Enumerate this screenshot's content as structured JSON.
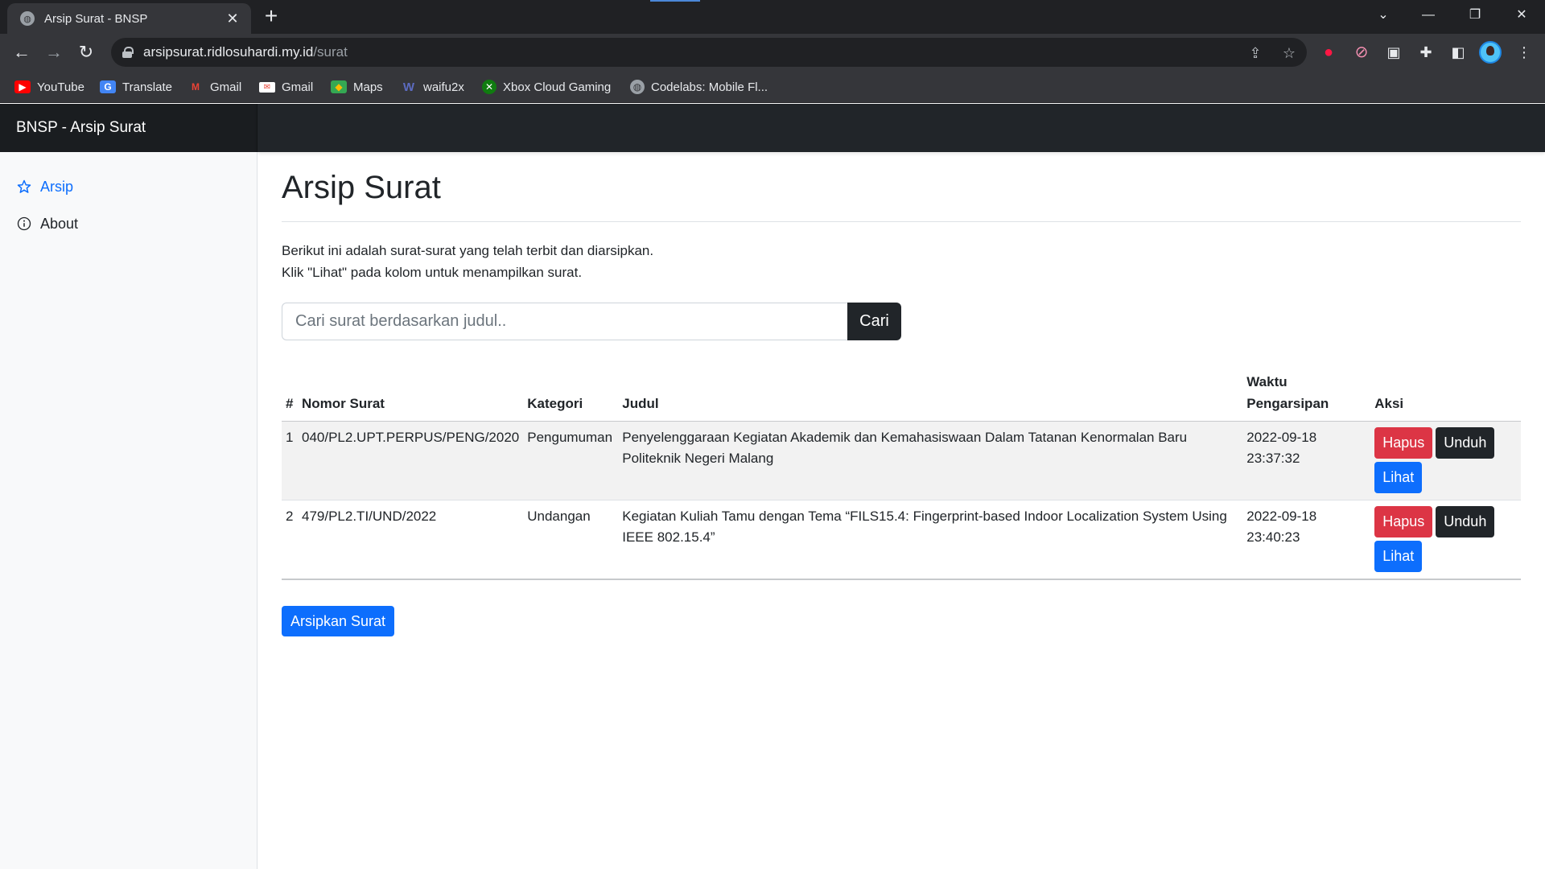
{
  "browser": {
    "tab_title": "Arsip Surat - BNSP",
    "url_host": "arsipsurat.ridlosuhardi.my.id",
    "url_path": "/surat",
    "bookmarks": [
      {
        "label": "YouTube",
        "icon": "youtube-icon",
        "color": "#ff0000"
      },
      {
        "label": "Translate",
        "icon": "translate-icon",
        "color": "#4285f4"
      },
      {
        "label": "Gmail",
        "icon": "gmail-icon",
        "color": "#ea4335"
      },
      {
        "label": "Gmail",
        "icon": "gmail-icon",
        "color": "#ea4335"
      },
      {
        "label": "Maps",
        "icon": "maps-icon",
        "color": "#34a853"
      },
      {
        "label": "waifu2x",
        "icon": "waifu2x-icon",
        "color": "#3f51b5"
      },
      {
        "label": "Xbox Cloud Gaming",
        "icon": "xbox-icon",
        "color": "#107c10"
      },
      {
        "label": "Codelabs: Mobile Fl...",
        "icon": "globe-icon",
        "color": "#9aa0a6"
      }
    ]
  },
  "app": {
    "brand": "BNSP - Arsip Surat"
  },
  "sidebar": {
    "items": [
      {
        "label": "Arsip",
        "icon": "star-icon",
        "active": true
      },
      {
        "label": "About",
        "icon": "info-icon",
        "active": false
      }
    ]
  },
  "main": {
    "title": "Arsip Surat",
    "intro_line1": "Berikut ini adalah surat-surat yang telah terbit dan diarsipkan.",
    "intro_line2": "Klik \"Lihat\" pada kolom untuk menampilkan surat.",
    "search": {
      "placeholder": "Cari surat berdasarkan judul..",
      "button": "Cari"
    },
    "table": {
      "headers": {
        "no": "#",
        "nomor": "Nomor Surat",
        "kategori": "Kategori",
        "judul": "Judul",
        "waktu_line1": "Waktu",
        "waktu_line2": "Pengarsipan",
        "aksi": "Aksi"
      },
      "actions": {
        "hapus": "Hapus",
        "unduh": "Unduh",
        "lihat": "Lihat"
      },
      "rows": [
        {
          "no": "1",
          "nomor": "040/PL2.UPT.PERPUS/PENG/2020",
          "kategori": "Pengumuman",
          "judul": "Penyelenggaraan Kegiatan Akademik dan Kemahasiswaan Dalam Tatanan Kenormalan Baru Politeknik Negeri Malang",
          "tanggal": "2022-09-18",
          "jam": "23:37:32"
        },
        {
          "no": "2",
          "nomor": "479/PL2.TI/UND/2022",
          "kategori": "Undangan",
          "judul": "Kegiatan Kuliah Tamu dengan Tema “FILS15.4: Fingerprint-based Indoor Localization System Using IEEE 802.15.4”",
          "tanggal": "2022-09-18",
          "jam": "23:40:23"
        }
      ]
    },
    "archive_button": "Arsipkan Surat"
  },
  "colors": {
    "primary": "#0d6efd",
    "danger": "#dc3545",
    "dark": "#212529"
  }
}
